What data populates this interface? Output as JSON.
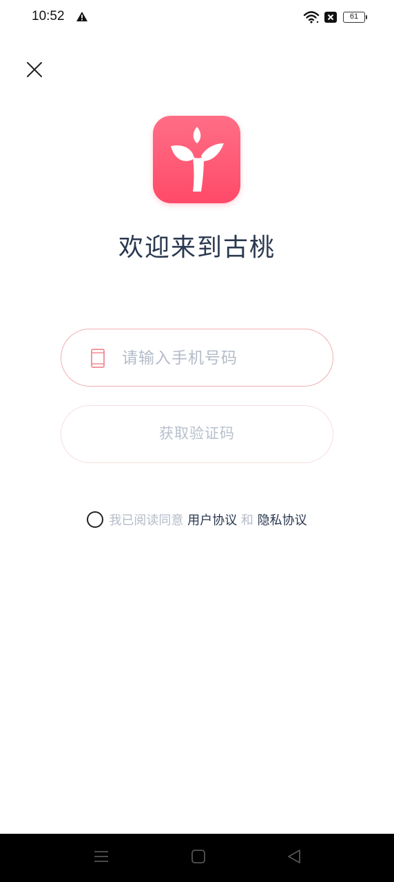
{
  "status_bar": {
    "time": "10:52",
    "battery": "61",
    "icons": [
      "warning-icon",
      "wifi-icon",
      "no-sim-icon",
      "battery-icon"
    ]
  },
  "header": {
    "close_icon": "close-icon"
  },
  "brand": {
    "logo_icon": "app-logo-icon",
    "welcome": "欢迎来到古桃",
    "accent_color": "#ff5573"
  },
  "login": {
    "phone_placeholder": "请输入手机号码",
    "phone_value": "",
    "phone_icon": "phone-icon",
    "get_code_label": "获取验证码"
  },
  "agreement": {
    "prefix": "我已阅读同意",
    "user_agreement": "用户协议",
    "and": "和",
    "privacy_policy": "隐私协议"
  },
  "nav_bar": {
    "icons": [
      "menu-icon",
      "home-icon",
      "back-icon"
    ]
  }
}
